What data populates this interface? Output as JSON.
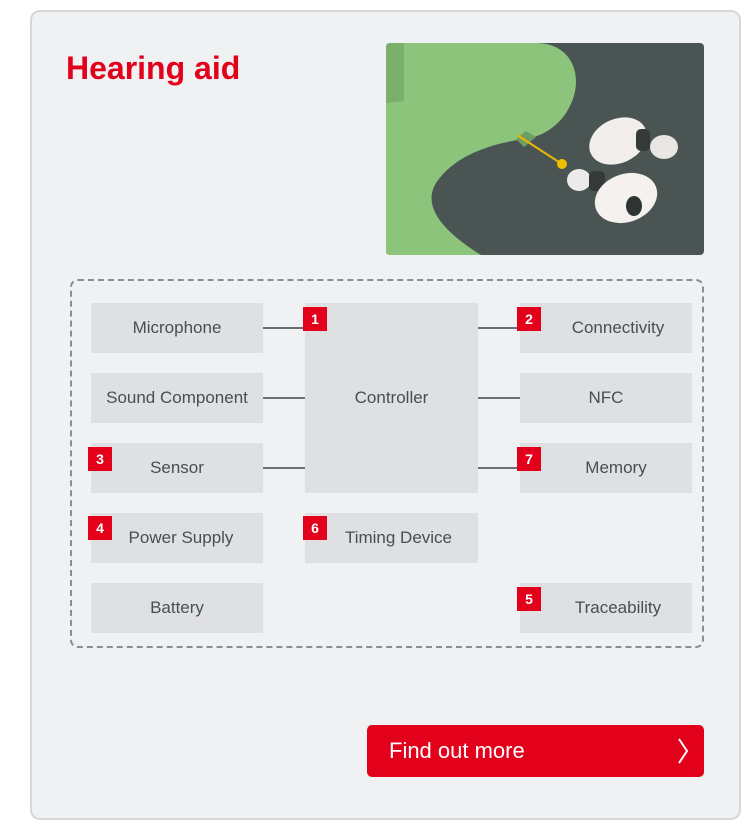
{
  "card": {
    "title": "Hearing aid",
    "hero_image": "hearing-aid-illustration"
  },
  "diagram": {
    "blocks": {
      "microphone": "Microphone",
      "sound_component": "Sound Component",
      "sensor": "Sensor",
      "power_supply": "Power Supply",
      "battery": "Battery",
      "controller": "Controller",
      "timing_device": "Timing Device",
      "connectivity": "Connectivity",
      "nfc": "NFC",
      "memory": "Memory",
      "traceability": "Traceability"
    },
    "badges": {
      "controller": "1",
      "connectivity": "2",
      "sensor": "3",
      "power_supply": "4",
      "traceability": "5",
      "timing_device": "6",
      "memory": "7"
    }
  },
  "cta": {
    "label": "Find out more",
    "icon": "chevron-right-icon"
  },
  "colors": {
    "accent": "#e2001a",
    "card_background": "#f0f1f2",
    "block_background": "#dfe0e2",
    "text": "#4a4d52"
  }
}
